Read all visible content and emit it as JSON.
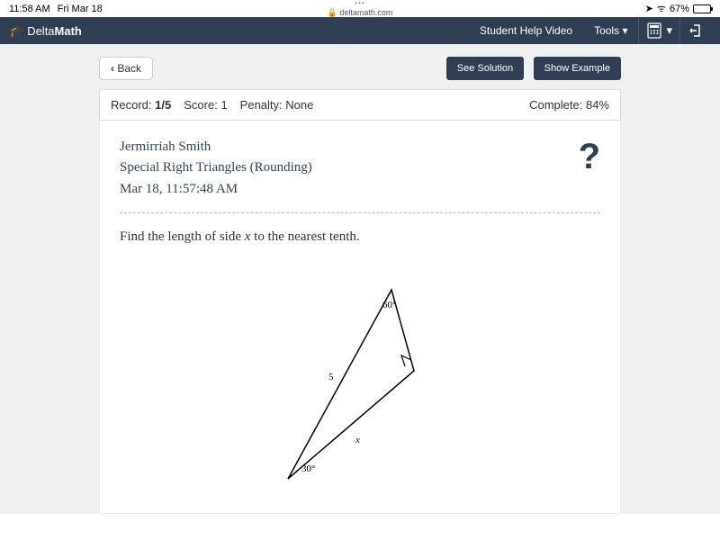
{
  "status": {
    "time": "11:58 AM",
    "date": "Fri Mar 18",
    "domain": "deltamath.com",
    "battery": "67%"
  },
  "nav": {
    "brand_a": "Delta",
    "brand_b": "Math",
    "help_video": "Student Help Video",
    "tools": "Tools"
  },
  "buttons": {
    "back": "Back",
    "see_solution": "See Solution",
    "show_example": "Show Example"
  },
  "record": {
    "label": "Record:",
    "value": "1/5",
    "score_label": "Score:",
    "score_value": "1",
    "penalty_label": "Penalty:",
    "penalty_value": "None",
    "complete_label": "Complete:",
    "complete_value": "84%"
  },
  "student": {
    "name": "Jermirriah Smith",
    "assignment": "Special Right Triangles (Rounding)",
    "timestamp": "Mar 18, 11:57:48 AM"
  },
  "prompt": {
    "pre": "Find the length of side ",
    "var": "x",
    "post": " to the nearest tenth."
  },
  "triangle": {
    "angle_top": "60°",
    "angle_bottom": "30°",
    "side_hyp": "5",
    "side_base": "x"
  }
}
